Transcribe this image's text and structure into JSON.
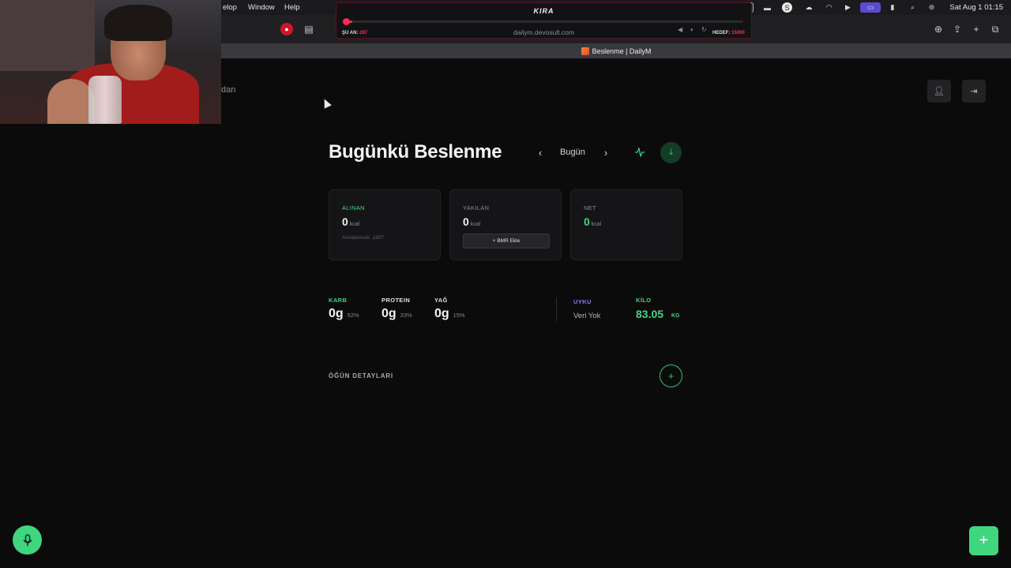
{
  "menubar": {
    "items": [
      "elop",
      "Window",
      "Help"
    ],
    "clock": "Sat Aug 1  01:15"
  },
  "stream_overlay": {
    "title": "KIRA",
    "current_label": "ŞU AN:",
    "current_value": "287",
    "target_label": "HEDEF:",
    "target_value": "15000",
    "progress": 0.019
  },
  "browser": {
    "url": "dailym.devosult.com",
    "tab_title": "Beslenme | DailyM"
  },
  "header": {
    "brand_fragment": "dan"
  },
  "main": {
    "title": "Bugünkü Beslenme",
    "date_label": "Bugün"
  },
  "cards": {
    "consumed": {
      "label": "ALINAN",
      "value": "0",
      "unit": "kcal",
      "sub": "Alınabilecek: 1897"
    },
    "burned": {
      "label": "YAKILAN",
      "value": "0",
      "unit": "kcal",
      "button": "+ BMR Ekle"
    },
    "net": {
      "label": "NET",
      "value": "0",
      "unit": "kcal"
    }
  },
  "macros": {
    "carb": {
      "label": "KARB",
      "value": "0g",
      "pct": "52%"
    },
    "protein": {
      "label": "PROTEIN",
      "value": "0g",
      "pct": "33%"
    },
    "fat": {
      "label": "YAĞ",
      "value": "0g",
      "pct": "15%"
    }
  },
  "sleep": {
    "label": "UYKU",
    "value": "Veri Yok"
  },
  "weight": {
    "label": "KİLO",
    "value": "83.05",
    "unit": "KG"
  },
  "meals": {
    "title": "ÖĞÜN DETAYLARI"
  },
  "colors": {
    "accent_green": "#3fd67e",
    "sleep_purple": "#8b7cf6",
    "alert_red": "#ff2d55"
  }
}
